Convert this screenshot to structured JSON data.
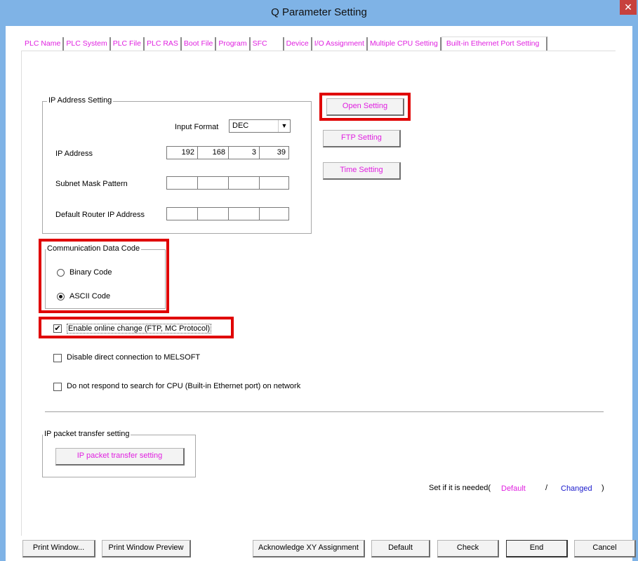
{
  "window": {
    "title": "Q Parameter Setting",
    "close_symbol": "✕"
  },
  "tabs": [
    "PLC Name",
    "PLC System",
    "PLC File",
    "PLC RAS",
    "Boot File",
    "Program",
    "SFC",
    "Device",
    "I/O Assignment",
    "Multiple CPU Setting",
    "Built-in Ethernet Port Setting"
  ],
  "ip_group": {
    "title": "IP Address Setting",
    "input_format_label": "Input Format",
    "input_format_value": "DEC",
    "ip_address_label": "IP Address",
    "ip_address": [
      "192",
      "168",
      "3",
      "39"
    ],
    "subnet_label": "Subnet Mask Pattern",
    "subnet": [
      "",
      "",
      "",
      ""
    ],
    "router_label": "Default Router IP Address",
    "router": [
      "",
      "",
      "",
      ""
    ]
  },
  "side_buttons": {
    "open_setting": "Open Setting",
    "ftp_setting": "FTP Setting",
    "time_setting": "Time Setting"
  },
  "comm_group": {
    "title": "Communication Data Code",
    "binary": "Binary Code",
    "ascii": "ASCII Code",
    "selected": "ASCII Code"
  },
  "options": {
    "enable_online": "Enable online change (FTP, MC Protocol)",
    "enable_online_checked": true,
    "disable_direct": "Disable direct connection to MELSOFT",
    "disable_direct_checked": false,
    "no_respond": "Do not respond to search for CPU (Built-in Ethernet port) on network",
    "no_respond_checked": false
  },
  "packet_group": {
    "title": "IP packet transfer setting",
    "button": "IP packet transfer setting"
  },
  "legend": {
    "prefix": "Set if it is needed(",
    "default": "Default",
    "slash": "/",
    "changed": "Changed",
    "suffix": ")"
  },
  "footer": {
    "print_window": "Print Window...",
    "print_preview": "Print Window Preview",
    "acknowledge": "Acknowledge XY Assignment",
    "default": "Default",
    "check": "Check",
    "end": "End",
    "cancel": "Cancel"
  },
  "colors": {
    "title_bar": "#7fb3e6",
    "highlight": "#e00000",
    "tab_text": "#e020e0",
    "changed_text": "#1a1acc"
  }
}
